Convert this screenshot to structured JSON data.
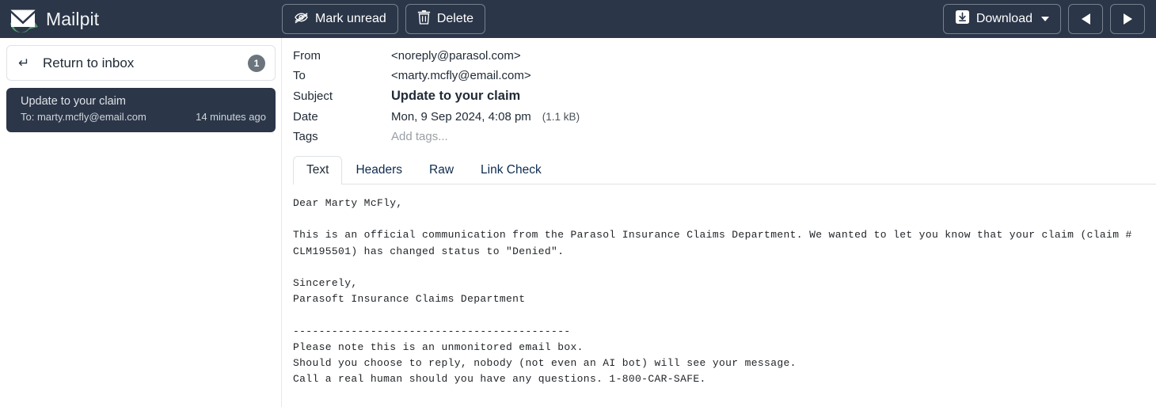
{
  "app": {
    "name": "Mailpit",
    "logo_icon": "mailpit-envelope-arrow-logo",
    "header_bg": "#2b3648",
    "accent_green": "#4f9e6e"
  },
  "toolbar": {
    "mark_unread": {
      "label": "Mark unread",
      "icon": "eye-slash-icon"
    },
    "delete": {
      "label": "Delete",
      "icon": "trash-icon"
    },
    "download": {
      "label": "Download",
      "icon": "download-icon",
      "caret": "▾"
    },
    "previous": {
      "label": "◀",
      "icon": "triangle-left-icon"
    },
    "next": {
      "label": "▶",
      "icon": "triangle-right-icon"
    }
  },
  "sidebar": {
    "return": {
      "label": "Return to inbox",
      "icon": "return-arrow-icon",
      "icon_glyph": "↵",
      "badge": "1"
    },
    "messages": [
      {
        "subject": "Update to your claim",
        "to": "To: marty.mcfly@email.com",
        "time": "14 minutes ago",
        "selected": true
      }
    ]
  },
  "message": {
    "headers": [
      {
        "label": "From",
        "value": "<noreply@parasol.com>",
        "type": "text"
      },
      {
        "label": "To",
        "value": "<marty.mcfly@email.com>",
        "type": "text"
      },
      {
        "label": "Subject",
        "value": "Update to your claim",
        "type": "subject"
      },
      {
        "label": "Date",
        "value": "Mon, 9 Sep 2024, 4:08 pm",
        "type": "date",
        "size": "(1.1 kB)"
      },
      {
        "label": "Tags",
        "value": "Add tags...",
        "type": "tags"
      }
    ],
    "tabs": [
      {
        "label": "Text",
        "active": true
      },
      {
        "label": "Headers",
        "active": false
      },
      {
        "label": "Raw",
        "active": false
      },
      {
        "label": "Link Check",
        "active": false
      }
    ],
    "body": "Dear Marty McFly,\n\nThis is an official communication from the Parasol Insurance Claims Department. We wanted to let you know that your claim (claim #\nCLM195501) has changed status to \"Denied\".\n\nSincerely,\nParasoft Insurance Claims Department\n\n-------------------------------------------\nPlease note this is an unmonitored email box.\nShould you choose to reply, nobody (not even an AI bot) will see your message.\nCall a real human should you have any questions. 1-800-CAR-SAFE."
  }
}
